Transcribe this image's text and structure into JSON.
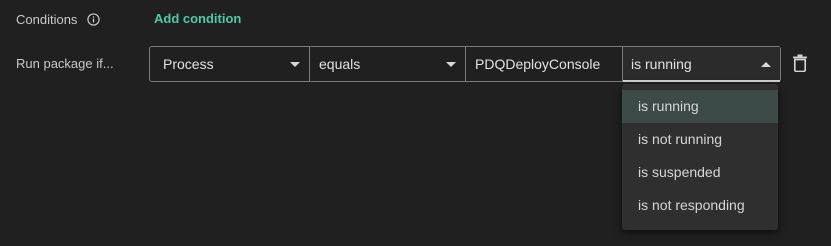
{
  "conditions": {
    "label": "Conditions",
    "info_icon": "info-icon",
    "add_label": "Add condition",
    "accent_color": "#4fc9a6"
  },
  "rule": {
    "label": "Run package if...",
    "type_value": "Process",
    "operator_value": "equals",
    "target_value": "PDQDeployConsole",
    "state_value": "is running",
    "delete_icon": "trash-icon"
  },
  "state_menu": {
    "selected": "is running",
    "options": [
      {
        "label": "is running"
      },
      {
        "label": "is not running"
      },
      {
        "label": "is suspended"
      },
      {
        "label": "is not responding"
      }
    ]
  }
}
